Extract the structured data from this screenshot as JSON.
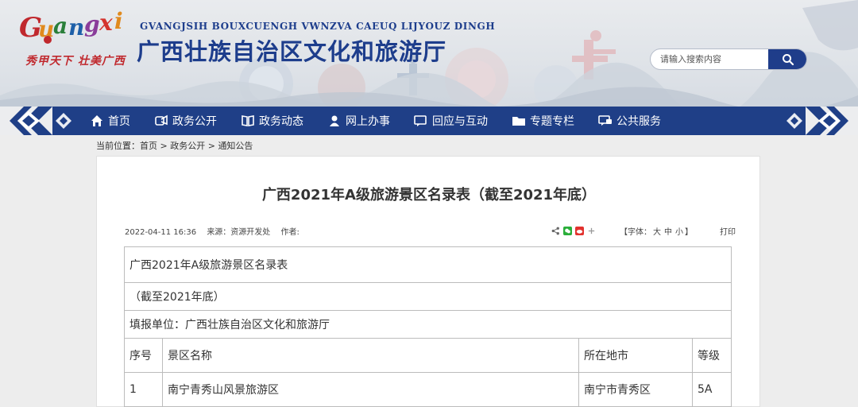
{
  "header": {
    "logo_text": "Guangxi",
    "slogan": "秀甲天下 壮美广西",
    "org_name_en": "GVANGJSIH BOUXCUENGH VWNZVA CAEUQ LIJYOUZ DINGH",
    "org_name_cn": "广西壮族自治区文化和旅游厅",
    "search_placeholder": "请输入搜索内容",
    "colors": {
      "brand_blue": "#1f3f87",
      "accent_red": "#c0282d"
    }
  },
  "nav": {
    "items": [
      {
        "label": "首页",
        "icon": "home-icon"
      },
      {
        "label": "政务公开",
        "icon": "open-gov-icon"
      },
      {
        "label": "政务动态",
        "icon": "news-book-icon"
      },
      {
        "label": "网上办事",
        "icon": "user-icon"
      },
      {
        "label": "回应与互动",
        "icon": "chat-icon"
      },
      {
        "label": "专题专栏",
        "icon": "folder-icon"
      },
      {
        "label": "公共服务",
        "icon": "service-chat-icon"
      }
    ]
  },
  "breadcrumb": {
    "prefix": "当前位置：",
    "items": [
      "首页",
      "政务公开",
      "通知公告"
    ],
    "separator": " > "
  },
  "article": {
    "title": "广西2021年A级旅游景区名录表（截至2021年底）",
    "date": "2022-04-11 16:36",
    "source": "来源：资源开发处",
    "author": "作者:",
    "font_label": "【字体：",
    "font_large": "大",
    "font_medium": "中",
    "font_small": "小",
    "font_close": "】",
    "print": "打印"
  },
  "table": {
    "title_row": "广西2021年A级旅游景区名录表",
    "date_row": "（截至2021年底）",
    "unit_row": "填报单位：广西壮族自治区文化和旅游厅",
    "headers": [
      "序号",
      "景区名称",
      "所在地市",
      "等级"
    ],
    "rows": [
      [
        "1",
        "南宁青秀山风景旅游区",
        "南宁市青秀区",
        "5A"
      ]
    ]
  }
}
